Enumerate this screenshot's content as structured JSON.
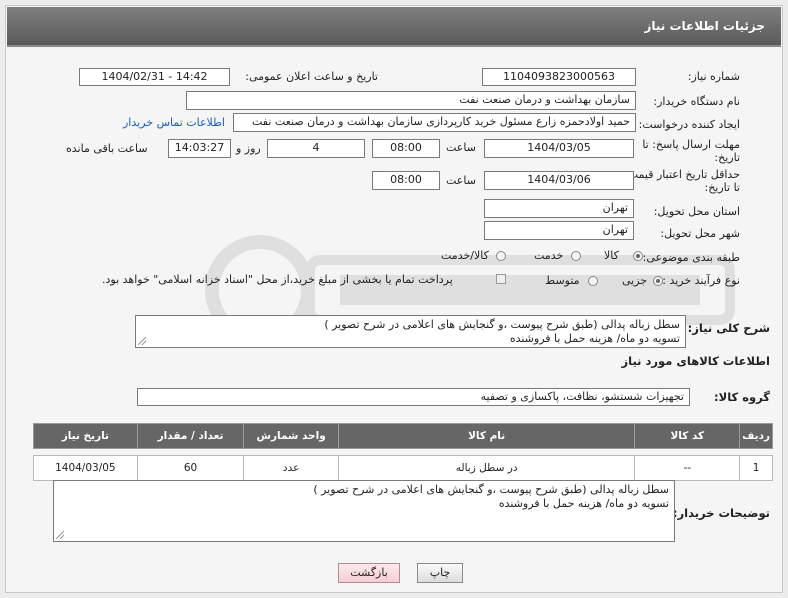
{
  "header": {
    "title": "جزئیات اطلاعات نیاز"
  },
  "form": {
    "need_number_label": "شماره نیاز:",
    "need_number": "1104093823000563",
    "announce_label": "تاریخ و ساعت اعلان عمومی:",
    "announce_value": "1404/02/31 - 14:42",
    "buyer_org_label": "نام دستگاه خریدار:",
    "buyer_org": "سازمان بهداشت و درمان صنعت نفت",
    "requester_label": "ایجاد کننده درخواست:",
    "requester": "حمید اولادحمزه زارع مسئول خرید کارپردازی سازمان بهداشت و درمان صنعت نفت",
    "contact_link": "اطلاعات تماس خریدار",
    "deadline_label_1": "مهلت ارسال پاسخ: تا",
    "deadline_label_2": "تاریخ:",
    "deadline_date": "1404/03/05",
    "time_label": "ساعت",
    "deadline_time": "08:00",
    "days_value": "4",
    "days_label": "روز و",
    "remaining_time": "14:03:27",
    "remaining_label": "ساعت باقی مانده",
    "validity_label_1": "حداقل تاریخ اعتبار قیمت:",
    "validity_label_2": "تا تاریخ:",
    "validity_date": "1404/03/06",
    "validity_time": "08:00",
    "province_label": "استان محل تحویل:",
    "province": "تهران",
    "city_label": "شهر محل تحویل:",
    "city": "تهران",
    "category_label": "طبقه بندی موضوعی:",
    "category_options": [
      "کالا",
      "خدمت",
      "کالا/خدمت"
    ],
    "category_selected": "کالا",
    "process_label": "نوع فرآیند خرید :",
    "process_options": [
      "جزیی",
      "متوسط"
    ],
    "process_selected": "جزیی",
    "payment_note": "پرداخت تمام یا بخشی از مبلغ خرید،از محل \"اسناد خزانه اسلامی\" خواهد بود.",
    "description_label": "شرح کلی نیاز:",
    "description_lines": [
      "سطل زباله پدالی (طبق شرح پیوست ،و گنجایش های اعلامی در شرح تصویر )",
      "تسویه دو ماه/ هزینه حمل با فروشنده"
    ]
  },
  "goods": {
    "section_title": "اطلاعات کالاهای مورد نیاز",
    "group_label": "گروه کالا:",
    "group_value": "تجهیزات شستشو، نظافت، پاکسازی و تصفیه",
    "columns": [
      "ردیف",
      "کد کالا",
      "نام کالا",
      "واحد شمارش",
      "تعداد / مقدار",
      "تاریخ نیاز"
    ],
    "rows": [
      {
        "row": "1",
        "code": "--",
        "name": "در سطل زباله",
        "unit": "عدد",
        "qty": "60",
        "date": "1404/03/05"
      }
    ]
  },
  "buyer_notes": {
    "label": "توضیحات خریدار:",
    "lines": [
      "سطل زباله پدالی (طبق شرح پیوست ،و گنجایش های اعلامی در شرح تصویر )",
      "تسویه دو ماه/ هزینه حمل با فروشنده"
    ]
  },
  "buttons": {
    "print": "چاپ",
    "back": "بازگشت"
  }
}
